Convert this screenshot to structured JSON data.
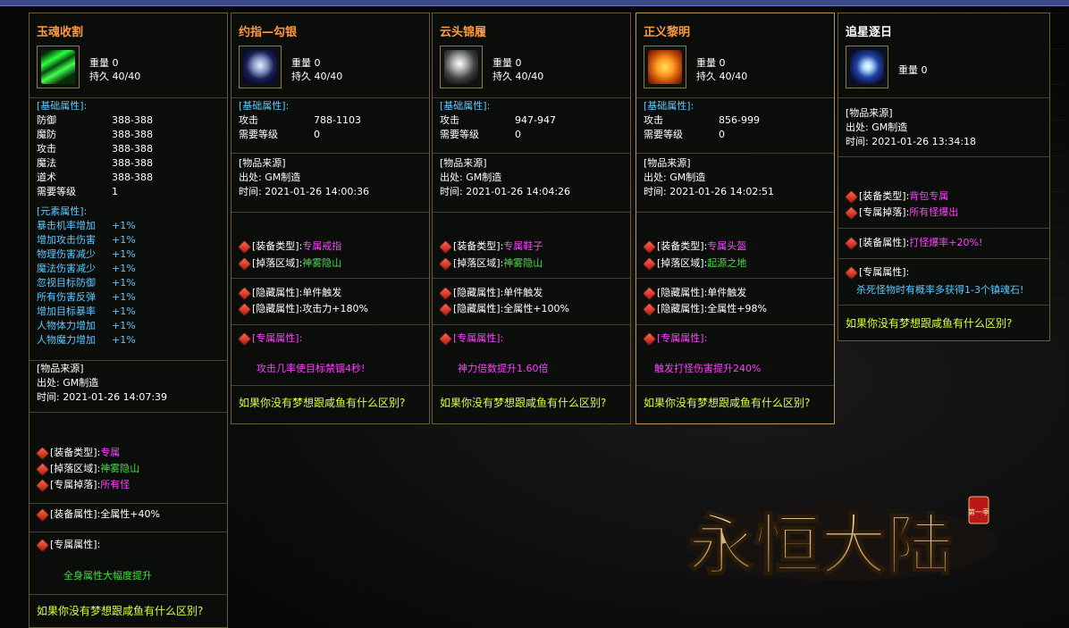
{
  "panels": {
    "p1": {
      "title": "玉魂收割",
      "weight": "重量 0",
      "durability": "持久 40/40",
      "base_header": "[基础属性]:",
      "base": [
        {
          "k": "防御",
          "v": "388-388"
        },
        {
          "k": "魔防",
          "v": "388-388"
        },
        {
          "k": "攻击",
          "v": "388-388"
        },
        {
          "k": "魔法",
          "v": "388-388"
        },
        {
          "k": "道术",
          "v": "388-388"
        },
        {
          "k": "需要等级",
          "v": "1"
        }
      ],
      "elem_header": "[元素属性]:",
      "elem": [
        {
          "k": "暴击机率增加",
          "v": "+1%"
        },
        {
          "k": "增加攻击伤害",
          "v": "+1%"
        },
        {
          "k": "物理伤害减少",
          "v": "+1%"
        },
        {
          "k": "魔法伤害减少",
          "v": "+1%"
        },
        {
          "k": "忽视目标防御",
          "v": "+1%"
        },
        {
          "k": "所有伤害反弹",
          "v": "+1%"
        },
        {
          "k": "增加目标暴率",
          "v": "+1%"
        },
        {
          "k": "人物体力增加",
          "v": "+1%"
        },
        {
          "k": "人物魔力增加",
          "v": "+1%"
        }
      ],
      "source_header": "[物品来源]",
      "source_origin": "出处: GM制造",
      "source_time": "时间: 2021-01-26 14:07:39",
      "equip_type_label": "[装备类型]:",
      "equip_type": "专属",
      "drop_area_label": "[掉落区域]:",
      "drop_area": "神雾隐山",
      "excl_drop_label": "[专属掉落]:",
      "excl_drop": "所有怪",
      "equip_attr_label": "[装备属性]:",
      "equip_attr": "全属性+40%",
      "excl_attr_label": "[专属属性]:",
      "excl_attr": "全身属性大幅度提升",
      "bottom": "如果你没有梦想跟咸鱼有什么区别?"
    },
    "p2": {
      "title": "约指—勾银",
      "weight": "重量 0",
      "durability": "持久 40/40",
      "base_header": "[基础属性]:",
      "base": [
        {
          "k": "攻击",
          "v": "788-1103"
        },
        {
          "k": "需要等级",
          "v": "0"
        }
      ],
      "source_header": "[物品来源]",
      "source_origin": "出处: GM制造",
      "source_time": "时间: 2021-01-26 14:00:36",
      "equip_type_label": "[装备类型]:",
      "equip_type": "专属戒指",
      "drop_area_label": "[掉落区域]:",
      "drop_area": "神雾隐山",
      "hidden1_label": "[隐藏属性]:",
      "hidden1": "单件触发",
      "hidden2_label": "[隐藏属性]:",
      "hidden2": "攻击力+180%",
      "excl_attr_label": "[专属属性]:",
      "excl_attr": "攻击几率使目标禁锢4秒!",
      "bottom": "如果你没有梦想跟咸鱼有什么区别?"
    },
    "p3": {
      "title": "云头锦履",
      "weight": "重量 0",
      "durability": "持久 40/40",
      "base_header": "[基础属性]:",
      "base": [
        {
          "k": "攻击",
          "v": "947-947"
        },
        {
          "k": "需要等级",
          "v": "0"
        }
      ],
      "source_header": "[物品来源]",
      "source_origin": "出处: GM制造",
      "source_time": "时间: 2021-01-26 14:04:26",
      "equip_type_label": "[装备类型]:",
      "equip_type": "专属鞋子",
      "drop_area_label": "[掉落区域]:",
      "drop_area": "神雾隐山",
      "hidden1_label": "[隐藏属性]:",
      "hidden1": "单件触发",
      "hidden2_label": "[隐藏属性]:",
      "hidden2": "全属性+100%",
      "excl_attr_label": "[专属属性]:",
      "excl_attr": "神力倍数提升1.60倍",
      "bottom": "如果你没有梦想跟咸鱼有什么区别?"
    },
    "p4": {
      "title": "正义黎明",
      "weight": "重量 0",
      "durability": "持久 40/40",
      "base_header": "[基础属性]:",
      "base": [
        {
          "k": "攻击",
          "v": "856-999"
        },
        {
          "k": "需要等级",
          "v": "0"
        }
      ],
      "source_header": "[物品来源]",
      "source_origin": "出处: GM制造",
      "source_time": "时间: 2021-01-26 14:02:51",
      "equip_type_label": "[装备类型]:",
      "equip_type": "专属头盔",
      "drop_area_label": "[掉落区域]:",
      "drop_area": "起源之地",
      "hidden1_label": "[隐藏属性]:",
      "hidden1": "单件触发",
      "hidden2_label": "[隐藏属性]:",
      "hidden2": "全属性+98%",
      "excl_attr_label": "[专属属性]:",
      "excl_attr": "触发打怪伤害提升240%",
      "bottom": "如果你没有梦想跟咸鱼有什么区别?"
    },
    "p5": {
      "title": "追星逐日",
      "weight": "重量 0",
      "source_header": "[物品来源]",
      "source_origin": "出处: GM制造",
      "source_time": "时间: 2021-01-26 13:34:18",
      "equip_type_label": "[装备类型]:",
      "equip_type": "背包专属",
      "excl_drop_label": "[专属掉落]:",
      "excl_drop": "所有怪爆出",
      "equip_attr_label": "[装备属性]:",
      "equip_attr": "打怪爆率+20%!",
      "excl_attr_label": "[专属属性]:",
      "excl_attr": "杀死怪物时有概率多获得1-3个镇魂石!",
      "bottom": "如果你没有梦想跟咸鱼有什么区别?"
    }
  },
  "logo": {
    "text": "永恒大陆",
    "badge": "第一季"
  },
  "colors": {
    "title": "#ff9a3c",
    "cyan": "#5fc8ff",
    "green": "#40e040",
    "magenta": "#ff40ff",
    "yellow": "#d8ff40",
    "border": "#6b5a3a"
  },
  "icons": {
    "p1": "green-blade-icon",
    "p2": "ring-icon",
    "p3": "boots-icon",
    "p4": "helmet-icon",
    "p5": "star-orb-icon"
  }
}
